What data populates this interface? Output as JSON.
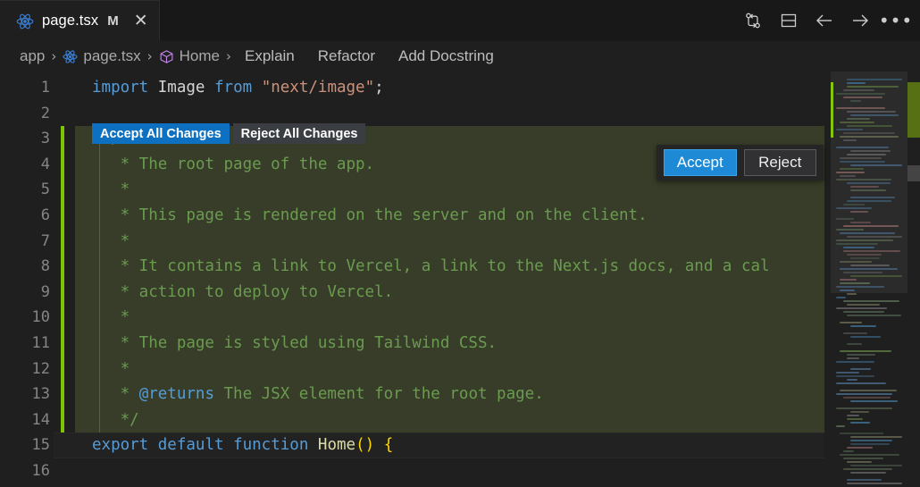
{
  "tab": {
    "icon": "react-icon",
    "title": "page.tsx",
    "modified_badge": "M",
    "close_label": "✕"
  },
  "titlebar_actions": [
    {
      "name": "compare-changes-icon",
      "label": "Compare Changes"
    },
    {
      "name": "split-editor-icon",
      "label": "Split Editor"
    },
    {
      "name": "back-arrow-icon",
      "label": "Go Back"
    },
    {
      "name": "forward-arrow-icon",
      "label": "Go Forward"
    },
    {
      "name": "more-actions-icon",
      "label": "•••"
    }
  ],
  "breadcrumb": {
    "separator": "›",
    "items": [
      {
        "label": "app",
        "icon": ""
      },
      {
        "label": "page.tsx",
        "icon": "react-icon"
      },
      {
        "label": "Home",
        "icon": "cube-icon"
      }
    ],
    "actions": [
      "Explain",
      "Refactor",
      "Add Docstring"
    ]
  },
  "inline_change_buttons": {
    "accept_all": "Accept All Changes",
    "reject_all": "Reject All Changes"
  },
  "accept_reject_widget": {
    "accept": "Accept",
    "reject": "Reject"
  },
  "colors": {
    "editor_background": "#1f1f1f",
    "tabbar_background": "#181818",
    "diff_added_background": "#373d29",
    "diff_added_gutter": "#7ec400",
    "accept_button": "#1e8ad6",
    "accept_all_button": "#0e70c0",
    "reject_all_button": "#3a3d41",
    "comment_text": "#6a9b4f",
    "keyword_text": "#569cd6",
    "string_text": "#ce9178",
    "linenumber_text": "#858585"
  },
  "editor": {
    "language": "typescriptreact",
    "first_visible_line": 1,
    "current_line": 15,
    "added_line_range": [
      3,
      14
    ],
    "lines": [
      {
        "no": "1",
        "added": false,
        "tokens": [
          {
            "t": "import",
            "c": "kw"
          },
          {
            "t": " ",
            "c": "punc"
          },
          {
            "t": "Image",
            "c": "id"
          },
          {
            "t": " ",
            "c": "punc"
          },
          {
            "t": "from",
            "c": "kw"
          },
          {
            "t": " ",
            "c": "punc"
          },
          {
            "t": "\"next/image\"",
            "c": "str"
          },
          {
            "t": ";",
            "c": "punc"
          }
        ]
      },
      {
        "no": "2",
        "added": false,
        "tokens": []
      },
      {
        "no": "3",
        "added": true,
        "tokens": [
          {
            "t": "  /**",
            "c": "comment"
          }
        ]
      },
      {
        "no": "4",
        "added": true,
        "tokens": [
          {
            "t": "   * The root page of the app.",
            "c": "comment"
          }
        ]
      },
      {
        "no": "5",
        "added": true,
        "tokens": [
          {
            "t": "   *",
            "c": "comment"
          }
        ]
      },
      {
        "no": "6",
        "added": true,
        "tokens": [
          {
            "t": "   * This page is rendered on the server and on the client.",
            "c": "comment"
          }
        ]
      },
      {
        "no": "7",
        "added": true,
        "tokens": [
          {
            "t": "   *",
            "c": "comment"
          }
        ]
      },
      {
        "no": "8",
        "added": true,
        "tokens": [
          {
            "t": "   * It contains a link to Vercel, a link to the Next.js docs, and a cal",
            "c": "comment"
          }
        ]
      },
      {
        "no": "9",
        "added": true,
        "tokens": [
          {
            "t": "   * action to deploy to Vercel.",
            "c": "comment"
          }
        ]
      },
      {
        "no": "10",
        "added": true,
        "tokens": [
          {
            "t": "   *",
            "c": "comment"
          }
        ]
      },
      {
        "no": "11",
        "added": true,
        "tokens": [
          {
            "t": "   * The page is styled using Tailwind CSS.",
            "c": "comment"
          }
        ]
      },
      {
        "no": "12",
        "added": true,
        "tokens": [
          {
            "t": "   *",
            "c": "comment"
          }
        ]
      },
      {
        "no": "13",
        "added": true,
        "tokens": [
          {
            "t": "   * ",
            "c": "comment"
          },
          {
            "t": "@returns",
            "c": "jsdoc"
          },
          {
            "t": " The JSX element for the root page.",
            "c": "comment"
          }
        ]
      },
      {
        "no": "14",
        "added": true,
        "tokens": [
          {
            "t": "   */",
            "c": "comment"
          }
        ]
      },
      {
        "no": "15",
        "added": false,
        "tokens": [
          {
            "t": "export",
            "c": "kw"
          },
          {
            "t": " ",
            "c": "punc"
          },
          {
            "t": "default",
            "c": "kw"
          },
          {
            "t": " ",
            "c": "punc"
          },
          {
            "t": "function",
            "c": "kw"
          },
          {
            "t": " ",
            "c": "punc"
          },
          {
            "t": "Home",
            "c": "fn"
          },
          {
            "t": "()",
            "c": "paren"
          },
          {
            "t": " ",
            "c": "punc"
          },
          {
            "t": "{",
            "c": "paren"
          }
        ]
      },
      {
        "no": "16",
        "added": false,
        "tokens": []
      }
    ]
  }
}
